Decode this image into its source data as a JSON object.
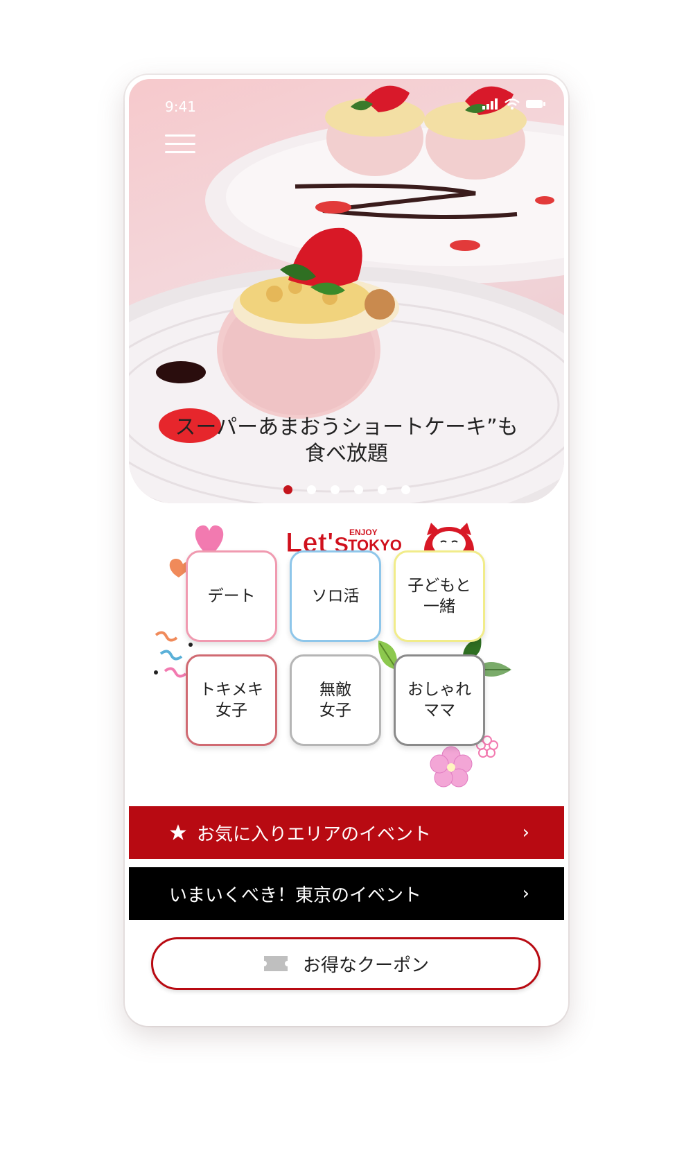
{
  "status_bar": {
    "time": "9:41"
  },
  "hero": {
    "caption_line1": "スーパーあまおうショートケーキ”も",
    "caption_line2": "食べ放題",
    "slide_count": 6,
    "active_slide": 1
  },
  "logo": {
    "lets": "Let's",
    "enjoy": "ENJOY",
    "tokyo": "TOKYO"
  },
  "categories": [
    {
      "line1": "デート",
      "line2": ""
    },
    {
      "line1": "ソロ活",
      "line2": ""
    },
    {
      "line1": "子どもと",
      "line2": "一緒"
    },
    {
      "line1": "トキメキ",
      "line2": "女子"
    },
    {
      "line1": "無敵",
      "line2": "女子"
    },
    {
      "line1": "おしゃれ",
      "line2": "ママ"
    }
  ],
  "banners": {
    "favorite_area": "お気に入りエリアのイベント",
    "tokyo_now": "いまいくべき！東京のイベント",
    "chevron": "›"
  },
  "coupon": {
    "label": "お得なクーポン"
  },
  "colors": {
    "brand_red": "#b80a12",
    "black": "#000000",
    "active_dot": "#c4141c"
  }
}
